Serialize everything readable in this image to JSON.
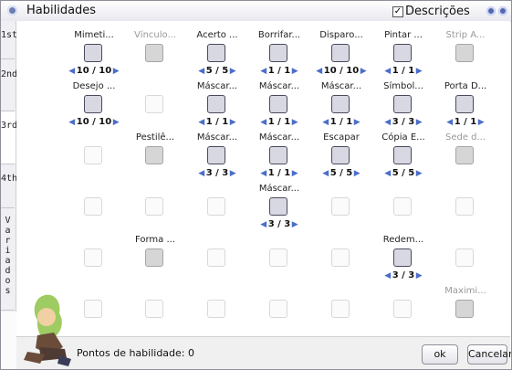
{
  "window": {
    "title": "Habilidades",
    "descriptions_label": "Descrições",
    "descriptions_checked": true
  },
  "tabs": [
    {
      "label": "1st"
    },
    {
      "label": "2nd"
    },
    {
      "label": "3rd"
    },
    {
      "label": "4th"
    },
    {
      "label": "Variados"
    }
  ],
  "skills": [
    {
      "name": "Mimeti...",
      "level": "10 / 10",
      "icon": "mimic-skill-icon",
      "state": "learned"
    },
    {
      "name": "Vínculo...",
      "level": "",
      "icon": "link-skill-icon",
      "state": "disabled"
    },
    {
      "name": "Acerto ...",
      "level": "5 / 5",
      "icon": "hit-skill-icon",
      "state": "learned"
    },
    {
      "name": "Borrifar...",
      "level": "1 / 1",
      "icon": "spray-skill-icon",
      "state": "learned"
    },
    {
      "name": "Disparo...",
      "level": "10 / 10",
      "icon": "shot-skill-icon",
      "state": "learned"
    },
    {
      "name": "Pintar ...",
      "level": "1 / 1",
      "icon": "paint-skill-icon",
      "state": "learned"
    },
    {
      "name": "Strip A...",
      "level": "",
      "icon": "strip-skill-icon",
      "state": "disabled"
    },
    {
      "name": "Desejo ...",
      "level": "10 / 10",
      "icon": "wish-skill-icon",
      "state": "learned"
    },
    {
      "name": "Máscar...",
      "level": "1 / 1",
      "icon": "mask-skill-icon",
      "state": "learned"
    },
    {
      "name": "Máscar...",
      "level": "1 / 1",
      "icon": "mask-skill-icon",
      "state": "learned"
    },
    {
      "name": "Máscar...",
      "level": "1 / 1",
      "icon": "mask-skill-icon",
      "state": "learned"
    },
    {
      "name": "Símbol...",
      "level": "3 / 3",
      "icon": "symbol-skill-icon",
      "state": "learned"
    },
    {
      "name": "Porta D...",
      "level": "1 / 1",
      "icon": "door-skill-icon",
      "state": "learned"
    },
    {
      "name": "Pestilê...",
      "level": "",
      "icon": "pestilence-skill-icon",
      "state": "disabled"
    },
    {
      "name": "Máscar...",
      "level": "3 / 3",
      "icon": "mask-skill-icon",
      "state": "learned"
    },
    {
      "name": "Máscar...",
      "level": "1 / 1",
      "icon": "mask-skill-icon",
      "state": "learned"
    },
    {
      "name": "Escapar",
      "level": "5 / 5",
      "icon": "escape-skill-icon",
      "state": "learned"
    },
    {
      "name": "Cópia E...",
      "level": "5 / 5",
      "icon": "copy-skill-icon",
      "state": "learned"
    },
    {
      "name": "Sede d...",
      "level": "",
      "icon": "thirst-skill-icon",
      "state": "disabled"
    },
    {
      "name": "Máscar...",
      "level": "3 / 3",
      "icon": "mask-skill-icon",
      "state": "learned"
    },
    {
      "name": "Forma ...",
      "level": "",
      "icon": "form-skill-icon",
      "state": "disabled"
    },
    {
      "name": "Redem...",
      "level": "3 / 3",
      "icon": "redemption-skill-icon",
      "state": "learned"
    },
    {
      "name": "Maximi...",
      "level": "",
      "icon": "maximize-skill-icon",
      "state": "disabled"
    }
  ],
  "footer": {
    "points_label": "Pontos de habilidade: 0",
    "ok_label": "ok",
    "cancel_label": "Cancelar"
  },
  "colors": {
    "arrow": "#4a6ec9",
    "disabled_text": "#999999",
    "icon_border": "#4a4a5e"
  }
}
